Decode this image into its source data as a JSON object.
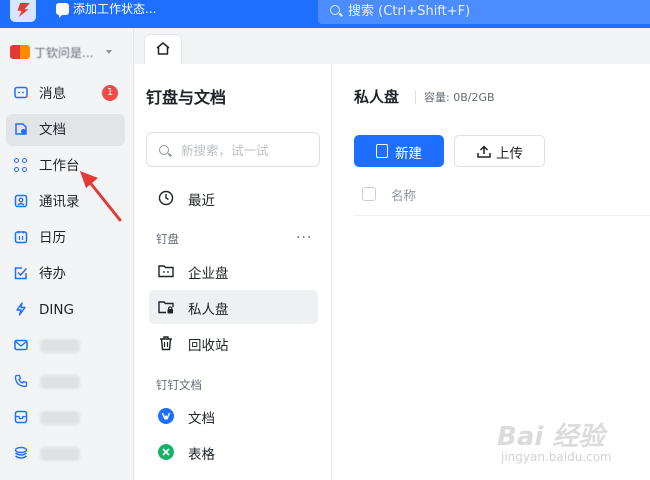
{
  "topbar": {
    "status_text": "添加工作状态...",
    "search_placeholder": "搜索 (Ctrl+Shift+F)"
  },
  "profile": {
    "name": "丁钦问是..."
  },
  "nav": {
    "items": [
      {
        "label": "消息",
        "icon": "message-icon",
        "badge": "1"
      },
      {
        "label": "文档",
        "icon": "document-icon",
        "active": true
      },
      {
        "label": "工作台",
        "icon": "grid-apps-icon"
      },
      {
        "label": "通讯录",
        "icon": "contacts-icon"
      },
      {
        "label": "日历",
        "icon": "calendar-icon"
      },
      {
        "label": "待办",
        "icon": "todo-check-icon"
      },
      {
        "label": "DING",
        "icon": "lightning-icon"
      }
    ],
    "blurred_items_icons": [
      "mail-icon",
      "phone-icon",
      "box-icon",
      "layers-icon"
    ]
  },
  "docs_panel": {
    "title": "钉盘与文档",
    "search_placeholder": "新搜索，试一试",
    "recent_label": "最近",
    "section_pan": "钉盘",
    "more": "···",
    "items": [
      {
        "label": "企业盘",
        "icon": "enterprise-folder-icon"
      },
      {
        "label": "私人盘",
        "icon": "private-folder-icon",
        "active": true
      },
      {
        "label": "回收站",
        "icon": "trash-icon"
      }
    ],
    "section_docs": "钉钉文档",
    "doc_items": [
      {
        "label": "文档",
        "icon": "doc-app-icon",
        "color": "#1e6fff"
      },
      {
        "label": "表格",
        "icon": "sheet-app-icon",
        "color": "#17b26a"
      }
    ]
  },
  "main": {
    "title": "私人盘",
    "capacity": "容量: 0B/2GB",
    "new_button": "新建",
    "upload_button": "上传",
    "column_name": "名称"
  },
  "watermark": {
    "main": "Bai 经验",
    "sub": "jingyan.baidu.com"
  },
  "colors": {
    "brand_blue": "#1e6fff",
    "badge_red": "#f54a45",
    "annotation_red": "#e53935"
  }
}
